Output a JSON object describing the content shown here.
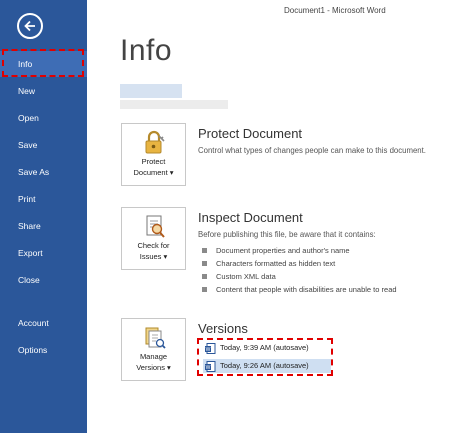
{
  "window": {
    "title": "Document1 - Microsoft Word"
  },
  "sidebar": {
    "items": [
      {
        "label": "Info"
      },
      {
        "label": "New"
      },
      {
        "label": "Open"
      },
      {
        "label": "Save"
      },
      {
        "label": "Save As"
      },
      {
        "label": "Print"
      },
      {
        "label": "Share"
      },
      {
        "label": "Export"
      },
      {
        "label": "Close"
      },
      {
        "label": "Account"
      },
      {
        "label": "Options"
      }
    ]
  },
  "main": {
    "title": "Info",
    "protect": {
      "button_line1": "Protect",
      "button_line2": "Document ▾",
      "title": "Protect Document",
      "description": "Control what types of changes people can make to this document."
    },
    "inspect": {
      "button_line1": "Check for",
      "button_line2": "Issues ▾",
      "title": "Inspect Document",
      "description": "Before publishing this file, be aware that it contains:",
      "bullets": [
        "Document properties and author's name",
        "Characters formatted as hidden text",
        "Custom XML data",
        "Content that people with disabilities are unable to read"
      ]
    },
    "versions": {
      "button_line1": "Manage",
      "button_line2": "Versions ▾",
      "title": "Versions",
      "items": [
        {
          "label": "Today, 9:39 AM (autosave)"
        },
        {
          "label": "Today, 9:26 AM (autosave)"
        }
      ]
    }
  },
  "colors": {
    "sidebar": "#2b579a",
    "highlight": "#e00000",
    "selected_row": "#cfdff2"
  },
  "icons": [
    "back-arrow-icon",
    "lock-key-icon",
    "inspect-document-icon",
    "manage-versions-icon",
    "word-document-icon"
  ]
}
